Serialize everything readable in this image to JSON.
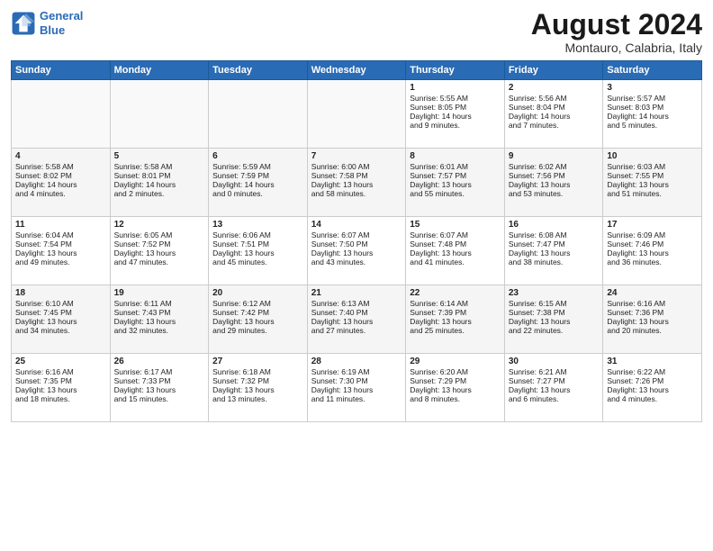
{
  "header": {
    "logo_line1": "General",
    "logo_line2": "Blue",
    "month": "August 2024",
    "location": "Montauro, Calabria, Italy"
  },
  "days_of_week": [
    "Sunday",
    "Monday",
    "Tuesday",
    "Wednesday",
    "Thursday",
    "Friday",
    "Saturday"
  ],
  "weeks": [
    [
      {
        "day": "",
        "content": ""
      },
      {
        "day": "",
        "content": ""
      },
      {
        "day": "",
        "content": ""
      },
      {
        "day": "",
        "content": ""
      },
      {
        "day": "1",
        "content": "Sunrise: 5:55 AM\nSunset: 8:05 PM\nDaylight: 14 hours\nand 9 minutes."
      },
      {
        "day": "2",
        "content": "Sunrise: 5:56 AM\nSunset: 8:04 PM\nDaylight: 14 hours\nand 7 minutes."
      },
      {
        "day": "3",
        "content": "Sunrise: 5:57 AM\nSunset: 8:03 PM\nDaylight: 14 hours\nand 5 minutes."
      }
    ],
    [
      {
        "day": "4",
        "content": "Sunrise: 5:58 AM\nSunset: 8:02 PM\nDaylight: 14 hours\nand 4 minutes."
      },
      {
        "day": "5",
        "content": "Sunrise: 5:58 AM\nSunset: 8:01 PM\nDaylight: 14 hours\nand 2 minutes."
      },
      {
        "day": "6",
        "content": "Sunrise: 5:59 AM\nSunset: 7:59 PM\nDaylight: 14 hours\nand 0 minutes."
      },
      {
        "day": "7",
        "content": "Sunrise: 6:00 AM\nSunset: 7:58 PM\nDaylight: 13 hours\nand 58 minutes."
      },
      {
        "day": "8",
        "content": "Sunrise: 6:01 AM\nSunset: 7:57 PM\nDaylight: 13 hours\nand 55 minutes."
      },
      {
        "day": "9",
        "content": "Sunrise: 6:02 AM\nSunset: 7:56 PM\nDaylight: 13 hours\nand 53 minutes."
      },
      {
        "day": "10",
        "content": "Sunrise: 6:03 AM\nSunset: 7:55 PM\nDaylight: 13 hours\nand 51 minutes."
      }
    ],
    [
      {
        "day": "11",
        "content": "Sunrise: 6:04 AM\nSunset: 7:54 PM\nDaylight: 13 hours\nand 49 minutes."
      },
      {
        "day": "12",
        "content": "Sunrise: 6:05 AM\nSunset: 7:52 PM\nDaylight: 13 hours\nand 47 minutes."
      },
      {
        "day": "13",
        "content": "Sunrise: 6:06 AM\nSunset: 7:51 PM\nDaylight: 13 hours\nand 45 minutes."
      },
      {
        "day": "14",
        "content": "Sunrise: 6:07 AM\nSunset: 7:50 PM\nDaylight: 13 hours\nand 43 minutes."
      },
      {
        "day": "15",
        "content": "Sunrise: 6:07 AM\nSunset: 7:48 PM\nDaylight: 13 hours\nand 41 minutes."
      },
      {
        "day": "16",
        "content": "Sunrise: 6:08 AM\nSunset: 7:47 PM\nDaylight: 13 hours\nand 38 minutes."
      },
      {
        "day": "17",
        "content": "Sunrise: 6:09 AM\nSunset: 7:46 PM\nDaylight: 13 hours\nand 36 minutes."
      }
    ],
    [
      {
        "day": "18",
        "content": "Sunrise: 6:10 AM\nSunset: 7:45 PM\nDaylight: 13 hours\nand 34 minutes."
      },
      {
        "day": "19",
        "content": "Sunrise: 6:11 AM\nSunset: 7:43 PM\nDaylight: 13 hours\nand 32 minutes."
      },
      {
        "day": "20",
        "content": "Sunrise: 6:12 AM\nSunset: 7:42 PM\nDaylight: 13 hours\nand 29 minutes."
      },
      {
        "day": "21",
        "content": "Sunrise: 6:13 AM\nSunset: 7:40 PM\nDaylight: 13 hours\nand 27 minutes."
      },
      {
        "day": "22",
        "content": "Sunrise: 6:14 AM\nSunset: 7:39 PM\nDaylight: 13 hours\nand 25 minutes."
      },
      {
        "day": "23",
        "content": "Sunrise: 6:15 AM\nSunset: 7:38 PM\nDaylight: 13 hours\nand 22 minutes."
      },
      {
        "day": "24",
        "content": "Sunrise: 6:16 AM\nSunset: 7:36 PM\nDaylight: 13 hours\nand 20 minutes."
      }
    ],
    [
      {
        "day": "25",
        "content": "Sunrise: 6:16 AM\nSunset: 7:35 PM\nDaylight: 13 hours\nand 18 minutes."
      },
      {
        "day": "26",
        "content": "Sunrise: 6:17 AM\nSunset: 7:33 PM\nDaylight: 13 hours\nand 15 minutes."
      },
      {
        "day": "27",
        "content": "Sunrise: 6:18 AM\nSunset: 7:32 PM\nDaylight: 13 hours\nand 13 minutes."
      },
      {
        "day": "28",
        "content": "Sunrise: 6:19 AM\nSunset: 7:30 PM\nDaylight: 13 hours\nand 11 minutes."
      },
      {
        "day": "29",
        "content": "Sunrise: 6:20 AM\nSunset: 7:29 PM\nDaylight: 13 hours\nand 8 minutes."
      },
      {
        "day": "30",
        "content": "Sunrise: 6:21 AM\nSunset: 7:27 PM\nDaylight: 13 hours\nand 6 minutes."
      },
      {
        "day": "31",
        "content": "Sunrise: 6:22 AM\nSunset: 7:26 PM\nDaylight: 13 hours\nand 4 minutes."
      }
    ]
  ]
}
